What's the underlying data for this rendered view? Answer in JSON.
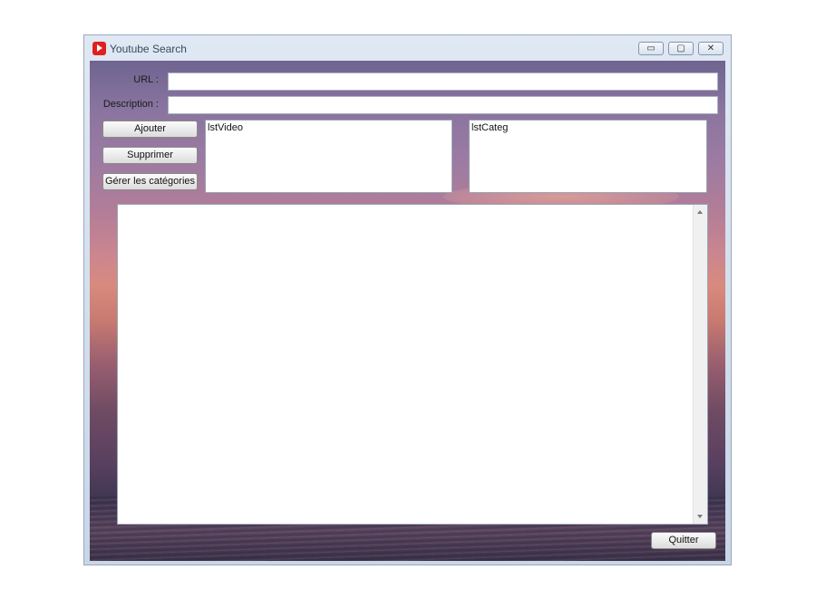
{
  "window": {
    "title": "Youtube Search",
    "controls": {
      "minimize": "▭",
      "maximize": "▢",
      "close": "✕"
    }
  },
  "form": {
    "url_label": "URL :",
    "url_value": "",
    "description_label": "Description :",
    "description_value": ""
  },
  "buttons": {
    "add": "Ajouter",
    "delete": "Supprimer",
    "manage_categories": "Gérer les catégories",
    "quit": "Quitter"
  },
  "lists": {
    "videos": "lstVideo",
    "categories": "lstCateg"
  }
}
